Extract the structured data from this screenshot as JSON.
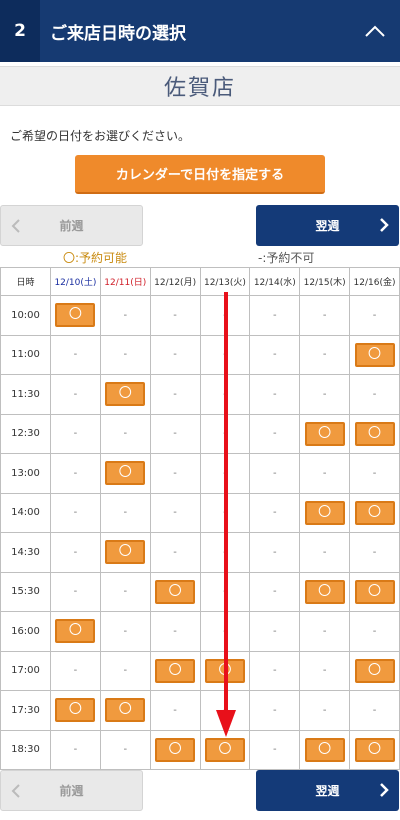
{
  "header": {
    "step": "2",
    "title": "ご来店日時の選択",
    "collapse_icon": "chevron-up-icon"
  },
  "store": {
    "name": "佐賀店"
  },
  "instruction": "ご希望の日付をお選びください。",
  "calendar_button": "カレンダーで日付を指定する",
  "nav": {
    "prev": "前週",
    "next": "翌週"
  },
  "legend": {
    "available": "〇:予約可能",
    "unavailable": "-:予約不可"
  },
  "grid": {
    "time_header": "日時",
    "days": [
      {
        "label": "12/10(土)",
        "kind": "sat"
      },
      {
        "label": "12/11(日)",
        "kind": "sun"
      },
      {
        "label": "12/12(月)",
        "kind": ""
      },
      {
        "label": "12/13(火)",
        "kind": ""
      },
      {
        "label": "12/14(水)",
        "kind": ""
      },
      {
        "label": "12/15(木)",
        "kind": ""
      },
      {
        "label": "12/16(金)",
        "kind": ""
      }
    ],
    "available_mark": "〇",
    "unavailable_mark": "-",
    "rows": [
      {
        "time": "10:00",
        "slots": [
          1,
          0,
          0,
          0,
          0,
          0,
          0
        ]
      },
      {
        "time": "11:00",
        "slots": [
          0,
          0,
          0,
          0,
          0,
          0,
          1
        ]
      },
      {
        "time": "11:30",
        "slots": [
          0,
          1,
          0,
          0,
          0,
          0,
          0
        ]
      },
      {
        "time": "12:30",
        "slots": [
          0,
          0,
          0,
          0,
          0,
          1,
          1
        ]
      },
      {
        "time": "13:00",
        "slots": [
          0,
          1,
          0,
          0,
          0,
          0,
          0
        ]
      },
      {
        "time": "14:00",
        "slots": [
          0,
          0,
          0,
          0,
          0,
          1,
          1
        ]
      },
      {
        "time": "14:30",
        "slots": [
          0,
          1,
          0,
          0,
          0,
          0,
          0
        ]
      },
      {
        "time": "15:30",
        "slots": [
          0,
          0,
          1,
          0,
          0,
          1,
          1
        ]
      },
      {
        "time": "16:00",
        "slots": [
          1,
          0,
          0,
          0,
          0,
          0,
          0
        ]
      },
      {
        "time": "17:00",
        "slots": [
          0,
          0,
          1,
          1,
          0,
          0,
          1
        ]
      },
      {
        "time": "17:30",
        "slots": [
          1,
          1,
          0,
          0,
          0,
          0,
          0
        ]
      },
      {
        "time": "18:30",
        "slots": [
          0,
          0,
          1,
          1,
          0,
          1,
          1
        ]
      }
    ]
  },
  "colors": {
    "header_bg": "#163a72",
    "accent_orange": "#ef8a2b",
    "arrow_red": "#e8101a"
  }
}
